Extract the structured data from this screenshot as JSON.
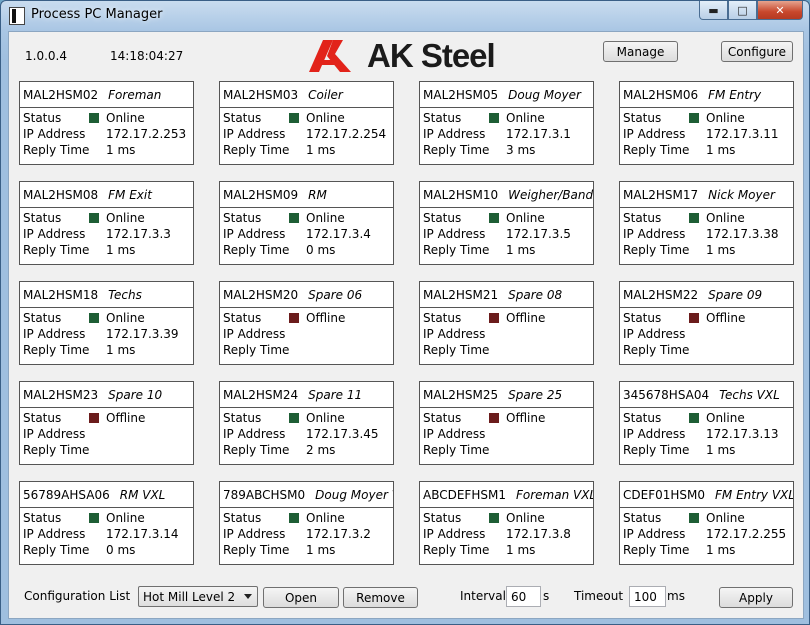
{
  "window": {
    "title": "Process PC Manager",
    "min_label": "▬",
    "max_label": "□",
    "close_label": "✕"
  },
  "header": {
    "version": "1.0.0.4",
    "time": "14:18:04:27",
    "logo_text": "AK Steel",
    "manage_label": "Manage",
    "configure_label": "Configure"
  },
  "labels": {
    "status": "Status",
    "ip": "IP Address",
    "reply": "Reply Time"
  },
  "colors": {
    "online": "#1e5e35",
    "offline": "#6b1c1c",
    "logo_red": "#e2231a"
  },
  "cards": [
    {
      "host": "MAL2HSM02",
      "role": "Foreman",
      "status": "Online",
      "ip": "172.17.2.253",
      "reply": "1 ms"
    },
    {
      "host": "MAL2HSM03",
      "role": "Coiler",
      "status": "Online",
      "ip": "172.17.2.254",
      "reply": "1 ms"
    },
    {
      "host": "MAL2HSM05",
      "role": "Doug Moyer",
      "status": "Online",
      "ip": "172.17.3.1",
      "reply": "3 ms"
    },
    {
      "host": "MAL2HSM06",
      "role": "FM Entry",
      "status": "Online",
      "ip": "172.17.3.11",
      "reply": "1 ms"
    },
    {
      "host": "MAL2HSM08",
      "role": "FM Exit",
      "status": "Online",
      "ip": "172.17.3.3",
      "reply": "1 ms"
    },
    {
      "host": "MAL2HSM09",
      "role": "RM",
      "status": "Online",
      "ip": "172.17.3.4",
      "reply": "0 ms"
    },
    {
      "host": "MAL2HSM10",
      "role": "Weigher/Bander",
      "status": "Online",
      "ip": "172.17.3.5",
      "reply": "1 ms"
    },
    {
      "host": "MAL2HSM17",
      "role": "Nick Moyer",
      "status": "Online",
      "ip": "172.17.3.38",
      "reply": "1 ms"
    },
    {
      "host": "MAL2HSM18",
      "role": "Techs",
      "status": "Online",
      "ip": "172.17.3.39",
      "reply": "1 ms"
    },
    {
      "host": "MAL2HSM20",
      "role": "Spare 06",
      "status": "Offline",
      "ip": "",
      "reply": ""
    },
    {
      "host": "MAL2HSM21",
      "role": "Spare 08",
      "status": "Offline",
      "ip": "",
      "reply": ""
    },
    {
      "host": "MAL2HSM22",
      "role": "Spare 09",
      "status": "Offline",
      "ip": "",
      "reply": ""
    },
    {
      "host": "MAL2HSM23",
      "role": "Spare 10",
      "status": "Offline",
      "ip": "",
      "reply": ""
    },
    {
      "host": "MAL2HSM24",
      "role": "Spare 11",
      "status": "Online",
      "ip": "172.17.3.45",
      "reply": "2 ms"
    },
    {
      "host": "MAL2HSM25",
      "role": "Spare 25",
      "status": "Offline",
      "ip": "",
      "reply": ""
    },
    {
      "host": "345678HSA04",
      "role": "Techs VXL",
      "status": "Online",
      "ip": "172.17.3.13",
      "reply": "1 ms"
    },
    {
      "host": "56789AHSA06",
      "role": "RM VXL",
      "status": "Online",
      "ip": "172.17.3.14",
      "reply": "0 ms"
    },
    {
      "host": "789ABCHSM0",
      "role": "Doug Moyer VXL",
      "status": "Online",
      "ip": "172.17.3.2",
      "reply": "1 ms"
    },
    {
      "host": "ABCDEFHSM1",
      "role": "Foreman VXL",
      "status": "Online",
      "ip": "172.17.3.8",
      "reply": "1 ms"
    },
    {
      "host": "CDEF01HSM0",
      "role": "FM Entry VXL",
      "status": "Online",
      "ip": "172.17.2.255",
      "reply": "1 ms"
    }
  ],
  "footer": {
    "config_label": "Configuration List",
    "config_value": "Hot Mill Level 2",
    "open_label": "Open",
    "remove_label": "Remove",
    "interval_label": "Interval",
    "interval_value": "60",
    "interval_unit": "s",
    "timeout_label": "Timeout",
    "timeout_value": "100",
    "timeout_unit": "ms",
    "apply_label": "Apply"
  }
}
